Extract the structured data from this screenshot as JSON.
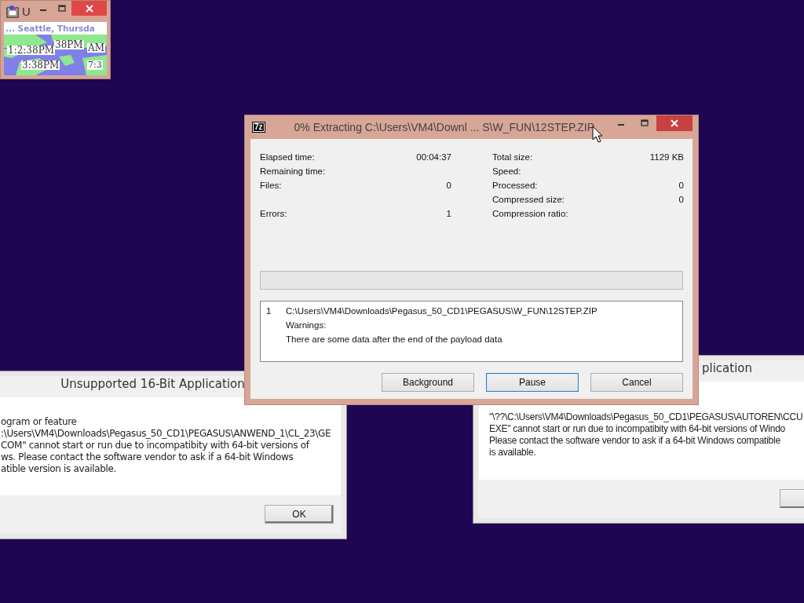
{
  "clock_window": {
    "title": "U",
    "header": "... Seattle, Thursda",
    "time_labels": [
      {
        "kind": "left",
        "text": "1:2:38PM"
      },
      {
        "kind": "top",
        "text": "38PM"
      },
      {
        "kind": "right",
        "text": "AM"
      },
      {
        "kind": "bottom",
        "text": "3:38PM"
      },
      {
        "kind": "corner",
        "text": "7:3"
      }
    ]
  },
  "left_dialog": {
    "title": "Unsupported 16-Bit Application",
    "message_lines": [
      "ogram or feature",
      ":\\Users\\VM4\\Downloads\\Pegasus_50_CD1\\PEGASUS\\ANWEND_1\\CL_23\\GE",
      "COM\" cannot start or run due to incompatibity with 64-bit versions of",
      "ws. Please contact the software vendor to ask if a 64-bit Windows",
      "atible version is available."
    ],
    "button": "OK"
  },
  "right_dialog": {
    "title": "plication",
    "message_lines": [
      "\"\\??\\C:\\Users\\VM4\\Downloads\\Pegasus_50_CD1\\PEGASUS\\AUTOREN\\CCU",
      "EXE\" cannot start or run due to incompatibity with 64-bit versions of Windo",
      "Please contact the software vendor to ask if a 64-bit Windows compatible",
      "is available."
    ]
  },
  "extract_window": {
    "icon_text": "7z",
    "title": "0% Extracting C:\\Users\\VM4\\Downl ... S\\W_FUN\\12STEP.ZIP",
    "stats_rows": [
      {
        "left": {
          "label": "Elapsed time:",
          "value": "00:04:37"
        },
        "right": {
          "label": "Total size:",
          "value": "1129 KB"
        }
      },
      {
        "left": {
          "label": "Remaining time:"
        },
        "right": {
          "label": "Speed:"
        }
      },
      {
        "left": {
          "label": "Files:",
          "value": "0"
        },
        "right": {
          "label": "Processed:",
          "value": "0"
        }
      },
      {
        "right": {
          "label": "Compressed size:",
          "value": "0"
        }
      },
      {
        "left": {
          "label": "Errors:",
          "value": "1"
        },
        "right": {
          "label": "Compression ratio:"
        }
      }
    ],
    "progress": {
      "level": 0
    },
    "log": [
      {
        "number": "1",
        "lines": [
          "C:\\Users\\VM4\\Downloads\\Pegasus_50_CD1\\PEGASUS\\W_FUN\\12STEP.ZIP",
          "Warnings:",
          "There are some data after the end of the payload data"
        ]
      }
    ],
    "buttons": [
      {
        "label": "Background",
        "focused": false
      },
      {
        "label": "Pause",
        "focused": true
      },
      {
        "label": "Cancel",
        "focused": false
      }
    ]
  }
}
